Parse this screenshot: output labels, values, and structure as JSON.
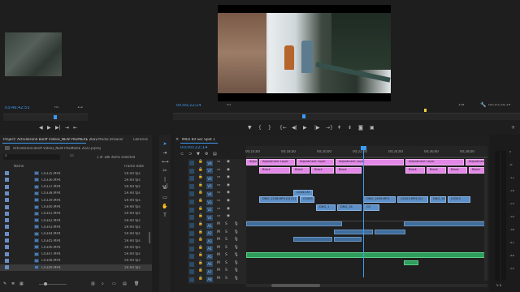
{
  "source_monitor": {
    "timecode": "03;46;42;53",
    "fit_label": "Fit",
    "ratio": "1/2"
  },
  "program_monitor": {
    "timecode": "00;00;22;14",
    "fit_label": "Fit",
    "ratio": "1/8",
    "duration": "00;10;16;19"
  },
  "project_panel": {
    "tabs": [
      "Project: Activebrand Banff Videos_NEW PREMIERE 2022",
      "Media Browser",
      "Libraries"
    ],
    "path": "Activebrand Banff Videos_NEW PREMIERE 2022.prproj",
    "selection_info": "1 of 186 items selected",
    "columns": {
      "name": "Name",
      "frame_rate": "Frame Rate"
    },
    "rows": [
      {
        "name": "C0335.MP4",
        "fps": "59.94 fps"
      },
      {
        "name": "C0336.MP4",
        "fps": "59.94 fps"
      },
      {
        "name": "C0337.MP4",
        "fps": "59.94 fps"
      },
      {
        "name": "C0338.MP4",
        "fps": "59.94 fps"
      },
      {
        "name": "C0339.MP4",
        "fps": "59.94 fps"
      },
      {
        "name": "C0340.MP4",
        "fps": "59.94 fps"
      },
      {
        "name": "C0341.MP4",
        "fps": "59.94 fps"
      },
      {
        "name": "C0342.MP4",
        "fps": "59.94 fps"
      },
      {
        "name": "C0343.MP4",
        "fps": "59.94 fps"
      },
      {
        "name": "C0344.MP4",
        "fps": "59.94 fps"
      },
      {
        "name": "C0345.MP4",
        "fps": "59.94 fps"
      },
      {
        "name": "C0346.MP4",
        "fps": "59.94 fps"
      },
      {
        "name": "C0347.MP4",
        "fps": "59.94 fps"
      },
      {
        "name": "C0348.MP4",
        "fps": "59.94 fps"
      },
      {
        "name": "C0349.MP4",
        "fps": "59.94 fps"
      }
    ]
  },
  "timeline": {
    "tab": "MILO 60 Sec Spot 1",
    "timecode": "00;00;22;14",
    "ruler": [
      "00;16;00",
      "00;18;00",
      "00;20;00",
      "00;22;00",
      "00;24;00",
      "00;26;00",
      "00;28;00"
    ],
    "video_tracks": [
      "V8",
      "V7",
      "V6",
      "V5",
      "V4",
      "V3",
      "V2",
      "V1"
    ],
    "audio_tracks": [
      "A1",
      "A2",
      "A3",
      "A4",
      "A5",
      "A6",
      "A7",
      "A8"
    ],
    "clips": {
      "adj": "Adjustment Layer",
      "black": "Black",
      "dng1": "DNG_1238.MP4 [V] [V]",
      "dng2": "C0343.M",
      "dng3": "C0343.MP4",
      "dng4": "DNG_1659.MP4",
      "dng5": "C0323.MP4 [V]",
      "dng6": "DNG_16",
      "dng7": "C0323",
      "v3a": "DNG_1",
      "v3b": "DNG_16",
      "v3c": "C0"
    }
  },
  "meters": {
    "scale": [
      "0",
      "-6",
      "-12",
      "-18",
      "-24",
      "-30",
      "-36",
      "-42",
      "-48",
      "-54"
    ],
    "footer": "S S"
  },
  "colors": {
    "accent": "#3d9af1",
    "adjustment": "#e288e6",
    "video": "#5d90c8",
    "audio": "#2f9e5d"
  }
}
